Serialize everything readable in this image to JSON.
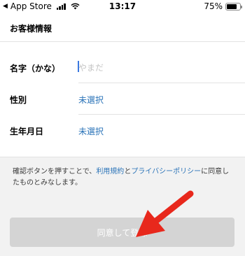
{
  "status_bar": {
    "back_label": "◀",
    "app_name": "App Store",
    "time": "13:17",
    "battery_percent": "75%",
    "battery_level": 0.75
  },
  "header": {
    "title": "お客様情報"
  },
  "form": {
    "name": {
      "label": "名字（かな）",
      "placeholder": "やまだ",
      "value": ""
    },
    "gender": {
      "label": "性別",
      "value": "未選択"
    },
    "birthday": {
      "label": "生年月日",
      "value": "未選択"
    }
  },
  "notice": {
    "text_before": "確認ボタンを押すことで、",
    "terms_link": "利用規約",
    "connector": "と",
    "privacy_link": "プライバシーポリシー",
    "text_after": "に同意したものとみなします。"
  },
  "submit": {
    "label": "同意して登録"
  },
  "colors": {
    "link": "#2a73b8",
    "disabled_button": "#d4d4d4",
    "annotation_arrow": "#e8281c"
  }
}
